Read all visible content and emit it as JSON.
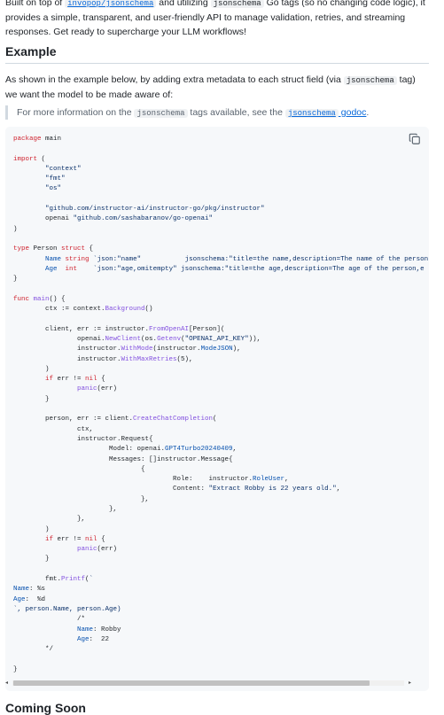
{
  "intro": {
    "prefix": "Built on top of ",
    "link": "invopop/jsonschema",
    "mid": " and utilizing ",
    "code": "jsonschema",
    "suffix": " Go tags (so no changing code logic), it provides a simple, transparent, and user-friendly API to manage validation, retries, and streaming responses. Get ready to supercharge your LLM workflows!"
  },
  "section": {
    "title": "Example",
    "para_prefix": "As shown in the example below, by adding extra metadata to each struct field (via ",
    "para_code": "jsonschema",
    "para_suffix": " tag) we want the model to be made aware of:"
  },
  "note": {
    "prefix": "For more information on the ",
    "code": "jsonschema",
    "mid": " tags available, see the ",
    "link_code": "jsonschema",
    "link_text": " godoc",
    "suffix": "."
  },
  "code": {
    "copy_icon": "copy-icon",
    "lines": [
      "package main",
      "",
      "import (",
      "        \"context\"",
      "        \"fmt\"",
      "        \"os\"",
      "",
      "        \"github.com/instructor-ai/instructor-go/pkg/instructor\"",
      "        openai \"github.com/sashabaranov/go-openai\"",
      ")",
      "",
      "type Person struct {",
      "        Name string `json:\"name\"           jsonschema:\"title=the name,description=The name of the person",
      "        Age  int    `json:\"age,omitempty\" jsonschema:\"title=the age,description=The age of the person,e",
      "}",
      "",
      "func main() {",
      "        ctx := context.Background()",
      "",
      "        client, err := instructor.FromOpenAI[Person](",
      "                openai.NewClient(os.Getenv(\"OPENAI_API_KEY\")),",
      "                instructor.WithMode(instructor.ModeJSON),",
      "                instructor.WithMaxRetries(5),",
      "        )",
      "        if err != nil {",
      "                panic(err)",
      "        }",
      "",
      "        person, err := client.CreateChatCompletion(",
      "                ctx,",
      "                instructor.Request{",
      "                        Model: openai.GPT4Turbo20240409,",
      "                        Messages: []instructor.Message{",
      "                                {",
      "                                        Role:    instructor.RoleUser,",
      "                                        Content: \"Extract Robby is 22 years old.\",",
      "                                },",
      "                        },",
      "                },",
      "        )",
      "        if err != nil {",
      "                panic(err)",
      "        }",
      "",
      "        fmt.Printf(`",
      "Name: %s",
      "Age:  %d",
      "`, person.Name, person.Age)",
      "                /*",
      "                Name: Robby",
      "                Age:  22",
      "        */",
      "",
      "}"
    ]
  },
  "next_section": {
    "title": "Coming Soon"
  }
}
